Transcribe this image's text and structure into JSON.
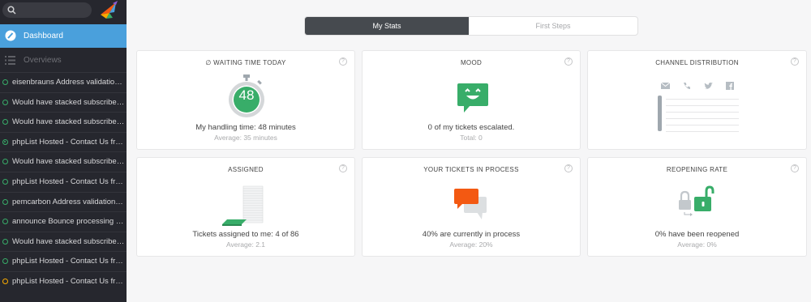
{
  "sidebar": {
    "dashboard_label": "Dashboard",
    "overviews_label": "Overviews",
    "tickets": [
      {
        "title": "eisenbrauns Address validation ...",
        "status": "open"
      },
      {
        "title": "Would have stacked subscriber ...",
        "status": "open"
      },
      {
        "title": "Would have stacked subscriber ...",
        "status": "open"
      },
      {
        "title": "phpList Hosted - Contact Us fro...",
        "status": "active"
      },
      {
        "title": "Would have stacked subscriber ...",
        "status": "open"
      },
      {
        "title": "phpList Hosted - Contact Us fro...",
        "status": "open"
      },
      {
        "title": "pemcarbon Address validation r...",
        "status": "open"
      },
      {
        "title": "announce Bounce processing info",
        "status": "open"
      },
      {
        "title": "Would have stacked subscriber ...",
        "status": "open"
      },
      {
        "title": "phpList Hosted - Contact Us fro...",
        "status": "open"
      },
      {
        "title": "phpList Hosted - Contact Us fro...",
        "status": "pending"
      }
    ]
  },
  "tabs": {
    "my_stats": "My Stats",
    "first_steps": "First Steps"
  },
  "cards": {
    "waiting": {
      "title": "∅ WAITING TIME TODAY",
      "value": "48",
      "main": "My handling time: 48 minutes",
      "sub": "Average: 35 minutes",
      "help": "?"
    },
    "mood": {
      "title": "MOOD",
      "main": "0 of my tickets escalated.",
      "sub": "Total: 0",
      "help": "?"
    },
    "channel": {
      "title": "CHANNEL DISTRIBUTION",
      "help": "?"
    },
    "assigned": {
      "title": "ASSIGNED",
      "main": "Tickets assigned to me: 4 of 86",
      "sub": "Average: 2.1",
      "help": "?"
    },
    "in_process": {
      "title": "YOUR TICKETS IN PROCESS",
      "main": "40% are currently in process",
      "sub": "Average: 20%",
      "help": "?"
    },
    "reopening": {
      "title": "REOPENING RATE",
      "main": "0% have been reopened",
      "sub": "Average: 0%",
      "help": "?"
    }
  },
  "colors": {
    "accent": "#4aa0dc",
    "green": "#38ad69",
    "orange": "#f35912",
    "sidebar": "#26272e"
  },
  "icons": [
    "search-icon",
    "logo-bird-icon",
    "dashboard-icon",
    "overviews-icon",
    "stopwatch-icon",
    "mood-smiley-icon",
    "mail-icon",
    "phone-icon",
    "twitter-icon",
    "facebook-icon",
    "ticket-stack-icon",
    "speech-bubbles-icon",
    "lock-icon",
    "unlock-icon",
    "help-icon"
  ]
}
